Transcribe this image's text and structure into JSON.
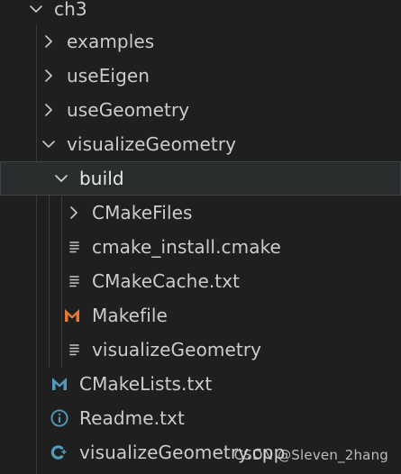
{
  "explorer": {
    "items": [
      {
        "label": "ch3",
        "kind": "folder",
        "expanded": true,
        "icon": "chevron-down-icon"
      },
      {
        "label": "examples",
        "kind": "folder",
        "expanded": false,
        "icon": "chevron-right-icon"
      },
      {
        "label": "useEigen",
        "kind": "folder",
        "expanded": false,
        "icon": "chevron-right-icon"
      },
      {
        "label": "useGeometry",
        "kind": "folder",
        "expanded": false,
        "icon": "chevron-right-icon"
      },
      {
        "label": "visualizeGeometry",
        "kind": "folder",
        "expanded": true,
        "icon": "chevron-down-icon"
      },
      {
        "label": "build",
        "kind": "folder",
        "expanded": true,
        "selected": true,
        "icon": "chevron-down-icon"
      },
      {
        "label": "CMakeFiles",
        "kind": "folder",
        "expanded": false,
        "icon": "chevron-right-icon"
      },
      {
        "label": "cmake_install.cmake",
        "kind": "file",
        "icon": "lines-icon"
      },
      {
        "label": "CMakeCache.txt",
        "kind": "file",
        "icon": "lines-icon"
      },
      {
        "label": "Makefile",
        "kind": "file",
        "icon": "makefile-m-icon"
      },
      {
        "label": "visualizeGeometry",
        "kind": "file",
        "icon": "lines-icon"
      },
      {
        "label": "CMakeLists.txt",
        "kind": "file",
        "icon": "cmake-m-icon"
      },
      {
        "label": "Readme.txt",
        "kind": "file",
        "icon": "info-icon"
      },
      {
        "label": "visualizeGeometry.cpp",
        "kind": "file",
        "icon": "cpp-icon"
      }
    ]
  },
  "watermark": "CSDN @Sleven_2hang",
  "colors": {
    "background": "#1f1f1f",
    "selected_row": "#2a2d2e",
    "text": "#cccccc",
    "makefile_icon": "#e37933",
    "cmake_icon": "#519aba",
    "info_icon": "#519aba",
    "cpp_icon": "#519aba"
  }
}
